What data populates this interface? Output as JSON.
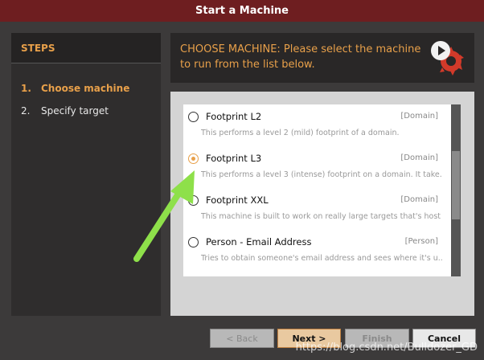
{
  "window": {
    "title": "Start a Machine"
  },
  "steps": {
    "header": "STEPS",
    "items": [
      {
        "num": "1.",
        "label": "Choose machine"
      },
      {
        "num": "2.",
        "label": "Specify target"
      }
    ]
  },
  "header": {
    "text": "CHOOSE MACHINE: Please select the machine to run from the list below."
  },
  "machines": [
    {
      "name": "Footprint L2",
      "category": "[Domain]",
      "description": "This performs a level 2 (mild) footprint of a domain.",
      "selected": false
    },
    {
      "name": "Footprint L3",
      "category": "[Domain]",
      "description": "This performs a level 3 (intense) footprint on a domain. It take.",
      "selected": true
    },
    {
      "name": "Footprint XXL",
      "category": "[Domain]",
      "description": "This machine is built to work on really large targets that's host",
      "selected": false
    },
    {
      "name": "Person - Email Address",
      "category": "[Person]",
      "description": "Tries to obtain someone's email address and sees where it's u..",
      "selected": false
    }
  ],
  "buttons": {
    "back": "< Back",
    "next": "Next >",
    "finish": "Finish",
    "cancel": "Cancel"
  },
  "watermark": "https://blog.csdn.net/Bulldozer_GD",
  "colors": {
    "accent": "#e8a04a",
    "titlebar": "#6e1e20",
    "arrow": "#8ee04a"
  }
}
